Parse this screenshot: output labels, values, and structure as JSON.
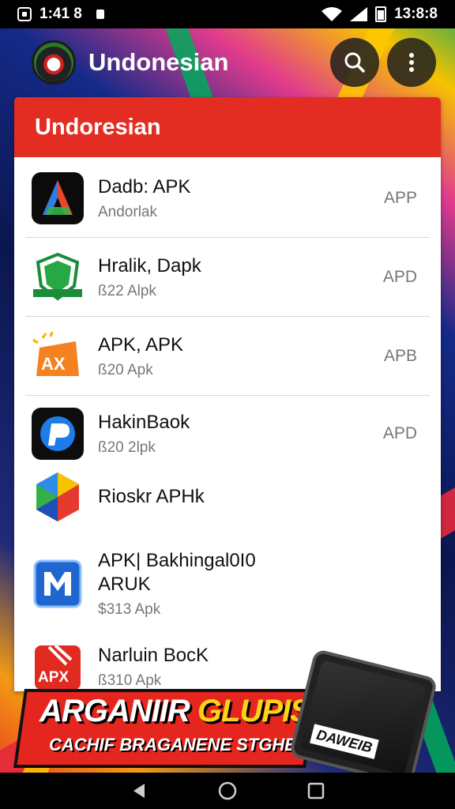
{
  "status_bar": {
    "left_time": "1:41 8",
    "right_time": "13:8:8"
  },
  "app_bar": {
    "title": "Undonesian",
    "icons": [
      "app-logo-icon",
      "search-icon",
      "more-vert-icon"
    ]
  },
  "card": {
    "header": "Undoresian",
    "items": [
      {
        "title": "Dadb: APK",
        "subtitle": "Andorlak",
        "tag": "APP",
        "icon": "a-logo-icon"
      },
      {
        "title": "Hralik, Dapk",
        "subtitle": "ß22 Alpk",
        "tag": "APD",
        "icon": "shield-icon"
      },
      {
        "title": "APK, APK",
        "subtitle": "ß20 Apk",
        "tag": "APB",
        "icon": "apx-logo-icon"
      },
      {
        "title": "HakinBaok",
        "subtitle": "ß20 2lpk",
        "tag": "APD",
        "icon": "p-logo-icon"
      },
      {
        "title": "Rioskr APHk",
        "subtitle": "",
        "tag": "",
        "icon": "hexagon-icon"
      },
      {
        "title": "APK| Bakhingal0I0",
        "title2": "ARUK",
        "subtitle": "$313 Apk",
        "tag": "",
        "icon": "blue-m-icon"
      },
      {
        "title": "Narluin BocK",
        "subtitle": "ß310 Apk",
        "tag": "",
        "icon": "apx-red-icon"
      }
    ]
  },
  "banner": {
    "line1_white": "ARGANIIR",
    "line1_yellow": "GLUPIS",
    "line2": "CACHIF BRAGANENE STGHEN",
    "phone_label": "DAWEIB"
  },
  "nav_bar": {
    "icons": [
      "back-icon",
      "home-icon",
      "recents-icon"
    ]
  },
  "colors": {
    "header_red": "#e32d22",
    "tag_gray": "#777777"
  }
}
